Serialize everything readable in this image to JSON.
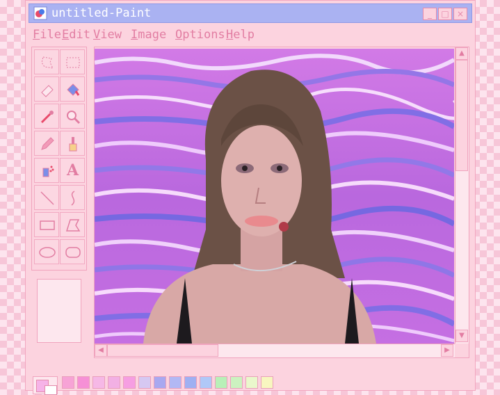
{
  "window": {
    "title": "untitled-Paint",
    "controls": {
      "minimize": "_",
      "maximize": "□",
      "close": "×"
    }
  },
  "menu": [
    {
      "label": "File",
      "key": "F",
      "rest": "ile"
    },
    {
      "label": "Edit",
      "key": "E",
      "rest": "dit"
    },
    {
      "label": "View",
      "key": "V",
      "rest": "iew"
    },
    {
      "label": "Image",
      "key": "I",
      "rest": "mage"
    },
    {
      "label": "Options",
      "key": "O",
      "rest": "ptions"
    },
    {
      "label": "Help",
      "key": "H",
      "rest": "elp"
    }
  ],
  "tools": [
    "free-form-select-icon",
    "rect-select-icon",
    "eraser-icon",
    "fill-bucket-icon",
    "color-picker-icon",
    "magnifier-icon",
    "pencil-icon",
    "brush-icon",
    "airbrush-icon",
    "text-icon",
    "line-icon",
    "curve-icon",
    "rectangle-icon",
    "polygon-icon",
    "ellipse-icon",
    "rounded-rectangle-icon"
  ],
  "text_tool_glyph": "A",
  "palette": {
    "foreground": "#f6b3e8",
    "background": "#ffffff",
    "colors": [
      "#f7a3d6",
      "#f690d6",
      "#f6b8e6",
      "#f2b0e4",
      "#f69ee2",
      "#d6c8f2",
      "#a9a8f0",
      "#b2b8f4",
      "#9fb0f2",
      "#b0c8f8",
      "#b8f0b8",
      "#ccf2c0",
      "#eaf8cc",
      "#f8f6c0"
    ]
  },
  "accent": "#e27da2",
  "titlebar_color": "#aab2f2"
}
